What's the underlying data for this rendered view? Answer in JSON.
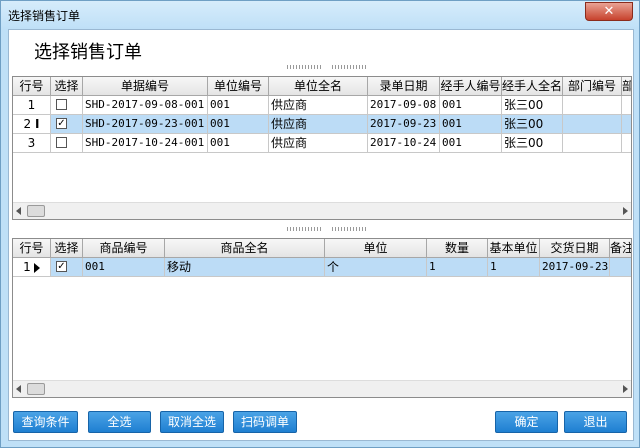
{
  "window": {
    "title": "选择销售订单",
    "close_label": "✕"
  },
  "header": {
    "title": "选择销售订单"
  },
  "orders": {
    "columns": [
      "行号",
      "选择",
      "单据编号",
      "单位编号",
      "单位全名",
      "录单日期",
      "经手人编号",
      "经手人全名",
      "部门编号",
      "部"
    ],
    "rows": [
      {
        "no": "1",
        "checked": false,
        "code": "SHD-2017-09-08-001",
        "unit_code": "001",
        "unit_name": "供应商",
        "date": "2017-09-08",
        "handler_code": "001",
        "handler_name": "张三00",
        "dept": ""
      },
      {
        "no": "2",
        "checked": true,
        "code": "SHD-2017-09-23-001",
        "unit_code": "001",
        "unit_name": "供应商",
        "date": "2017-09-23",
        "handler_code": "001",
        "handler_name": "张三00",
        "dept": "",
        "selected": true
      },
      {
        "no": "3",
        "checked": false,
        "code": "SHD-2017-10-24-001",
        "unit_code": "001",
        "unit_name": "供应商",
        "date": "2017-10-24",
        "handler_code": "001",
        "handler_name": "张三00",
        "dept": ""
      }
    ]
  },
  "items": {
    "columns": [
      "行号",
      "选择",
      "商品编号",
      "商品全名",
      "单位",
      "数量",
      "基本单位",
      "交货日期",
      "备注"
    ],
    "rows": [
      {
        "no": "1",
        "checked": true,
        "code": "001",
        "name": "移动",
        "unit": "个",
        "qty": "1",
        "base_unit": "1",
        "delivery": "2017-09-23",
        "note": ""
      }
    ]
  },
  "buttons": {
    "query": "查询条件",
    "select_all": "全选",
    "deselect_all": "取消全选",
    "scan": "扫码调单",
    "ok": "确定",
    "exit": "退出"
  }
}
